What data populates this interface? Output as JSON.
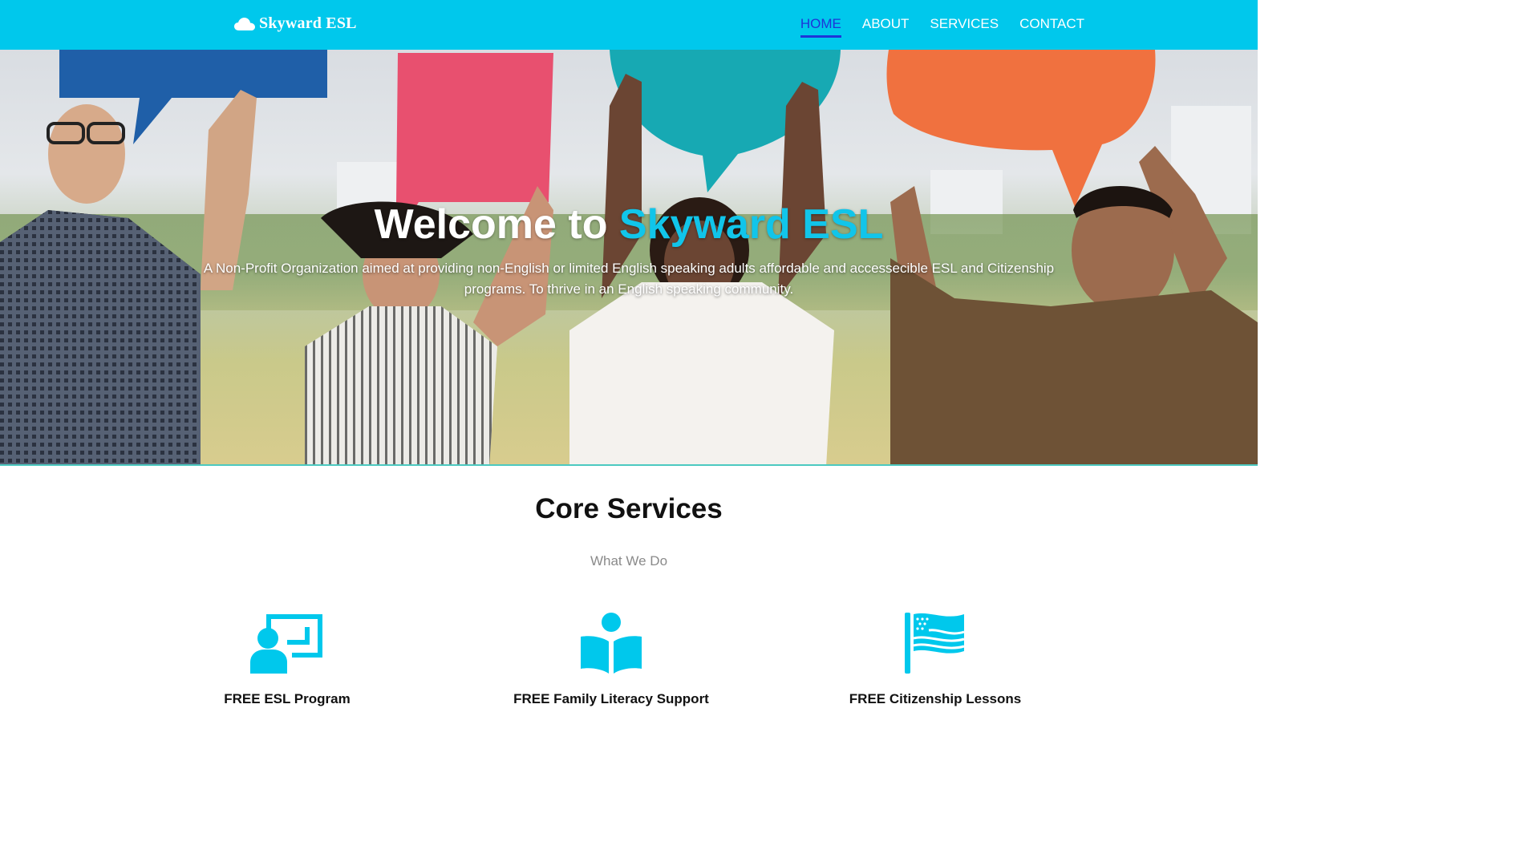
{
  "navbar": {
    "brand": "Skyward ESL",
    "brand_icon": "cloud-icon",
    "links": [
      "HOME",
      "ABOUT",
      "SERVICES",
      "CONTACT"
    ],
    "active": "HOME"
  },
  "hero": {
    "title_prefix": "Welcome to ",
    "title_accent": "Skyward ESL",
    "subtitle": "A Non-Profit Organization aimed at providing non-English or limited English speaking adults affordable and accessecible ESL and Citizenship programs. To thrive in an English speaking community."
  },
  "services": {
    "title": "Core Services",
    "subtitle": "What We Do",
    "items": [
      {
        "label": "FREE ESL Program",
        "icon": "teacher-board-icon"
      },
      {
        "label": "FREE Family Literacy Support",
        "icon": "reader-book-icon"
      },
      {
        "label": "FREE Citizenship Lessons",
        "icon": "us-flag-icon"
      }
    ]
  },
  "colors": {
    "primary": "#00c8ec",
    "accent_text": "#11c5ea",
    "active_link": "#1e35d8",
    "bubble_blue": "#1f5fa8",
    "bubble_pink": "#e8506f",
    "bubble_teal": "#17a9b3",
    "bubble_orange": "#f0713f"
  }
}
